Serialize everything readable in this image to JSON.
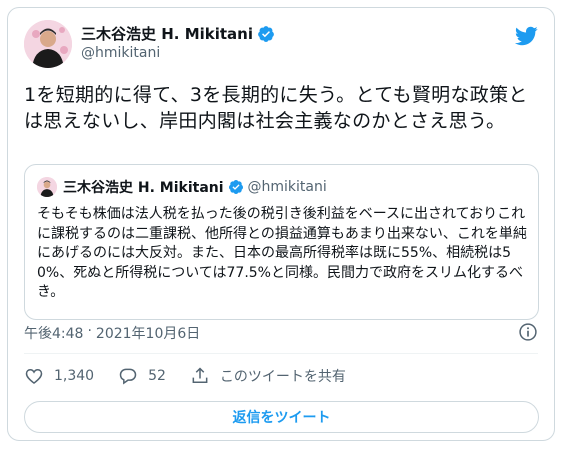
{
  "author": {
    "name": "三木谷浩史 H. Mikitani",
    "handle": "@hmikitani"
  },
  "tweet": {
    "text": "1を短期的に得て、3を長期的に失う。とても賢明な政策とは思えないし、岸田内閣は社会主義なのかとさえ思う。"
  },
  "quoted": {
    "name": "三木谷浩史 H. Mikitani",
    "handle": "@hmikitani",
    "text": "そもそも株価は法人税を払った後の税引き後利益をベースに出されておりこれに課税するのは二重課税、他所得との損益通算もあまり出来ない、これを単純にあげるのには大反対。また、日本の最高所得税率は既に55%、相続税は50%、死ぬと所得税については77.5%と同様。民間力で政府をスリム化するべき。"
  },
  "meta": {
    "time": "午後4:48",
    "separator": "·",
    "date": "2021年10月6日"
  },
  "actions": {
    "likes": "1,340",
    "replies": "52",
    "share_label": "このツイートを共有"
  },
  "reply_button_label": "返信をツイート",
  "colors": {
    "accent": "#1d9bf0",
    "like": "#f91880",
    "text": "#0f1419",
    "muted": "#536471",
    "border": "#cfd9de"
  },
  "icons": [
    "verified-badge-icon",
    "twitter-bird-icon",
    "info-icon",
    "heart-icon",
    "reply-icon",
    "share-icon"
  ]
}
